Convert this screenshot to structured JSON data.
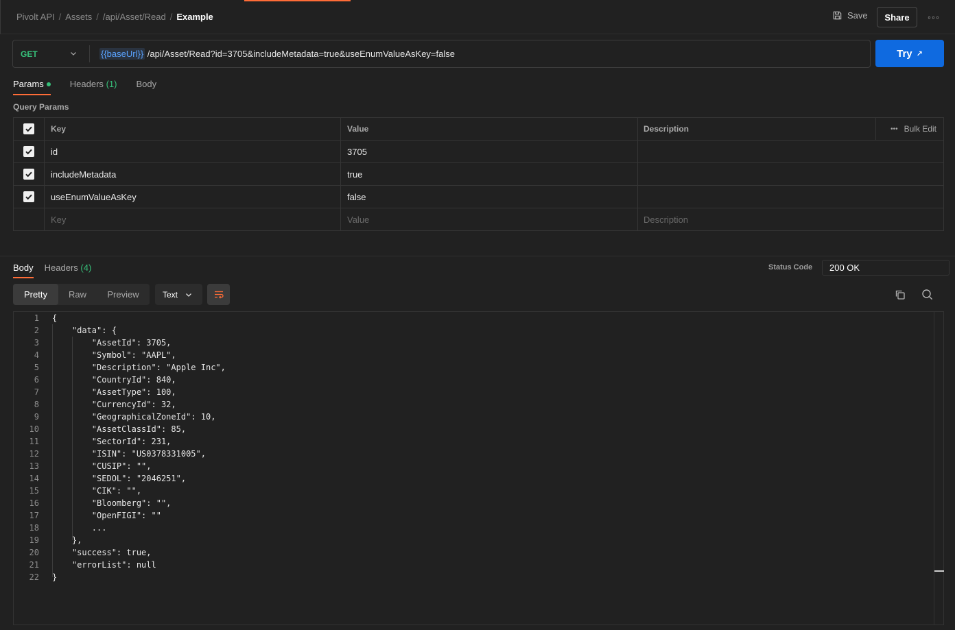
{
  "breadcrumb": {
    "items": [
      "Pivolt API",
      "Assets",
      "/api/Asset/Read"
    ],
    "separator": "/",
    "current": "Example"
  },
  "header": {
    "save_label": "Save",
    "share_label": "Share",
    "more_label": "◦◦◦"
  },
  "request": {
    "method": "GET",
    "url_variable": "{{baseUrl}}",
    "url_path": " /api/Asset/Read?id=3705&includeMetadata=true&useEnumValueAsKey=false",
    "try_label": "Try",
    "try_arrow": "↗"
  },
  "request_tabs": [
    {
      "label": "Params",
      "count": ""
    },
    {
      "label": "Headers",
      "count": "(1)"
    },
    {
      "label": "Body",
      "count": ""
    }
  ],
  "query_params": {
    "title": "Query Params",
    "columns": {
      "key": "Key",
      "value": "Value",
      "description": "Description"
    },
    "bulk_edit_label": "Bulk Edit",
    "bulk_edit_dots": "•••",
    "rows": [
      {
        "key": "id",
        "value": "3705",
        "description": ""
      },
      {
        "key": "includeMetadata",
        "value": "true",
        "description": ""
      },
      {
        "key": "useEnumValueAsKey",
        "value": "false",
        "description": ""
      }
    ],
    "placeholder": {
      "key": "Key",
      "value": "Value",
      "description": "Description"
    }
  },
  "response": {
    "tabs": [
      {
        "label": "Body",
        "count": ""
      },
      {
        "label": "Headers",
        "count": "(4)"
      }
    ],
    "status_label": "Status Code",
    "status_value": "200 OK",
    "view_modes": [
      "Pretty",
      "Raw",
      "Preview"
    ],
    "format": "Text",
    "code_lines": [
      "{",
      "    \"data\": {",
      "        \"AssetId\": 3705,",
      "        \"Symbol\": \"AAPL\",",
      "        \"Description\": \"Apple Inc\",",
      "        \"CountryId\": 840,",
      "        \"AssetType\": 100,",
      "        \"CurrencyId\": 32,",
      "        \"GeographicalZoneId\": 10,",
      "        \"AssetClassId\": 85,",
      "        \"SectorId\": 231,",
      "        \"ISIN\": \"US0378331005\",",
      "        \"CUSIP\": \"\",",
      "        \"SEDOL\": \"2046251\",",
      "        \"CIK\": \"\",",
      "        \"Bloomberg\": \"\",",
      "        \"OpenFIGI\": \"\"",
      "        ...",
      "    },",
      "    \"success\": true,",
      "    \"errorList\": null",
      "}"
    ]
  },
  "colors": {
    "accent": "#ff6c37",
    "primary_button": "#0f6ae0",
    "method_get": "#37c07a",
    "variable": "#5aa3ff"
  },
  "icons": [
    "save-icon",
    "chevron-down-icon",
    "check-icon",
    "word-wrap-icon",
    "copy-icon",
    "search-icon",
    "external-arrow-icon"
  ]
}
